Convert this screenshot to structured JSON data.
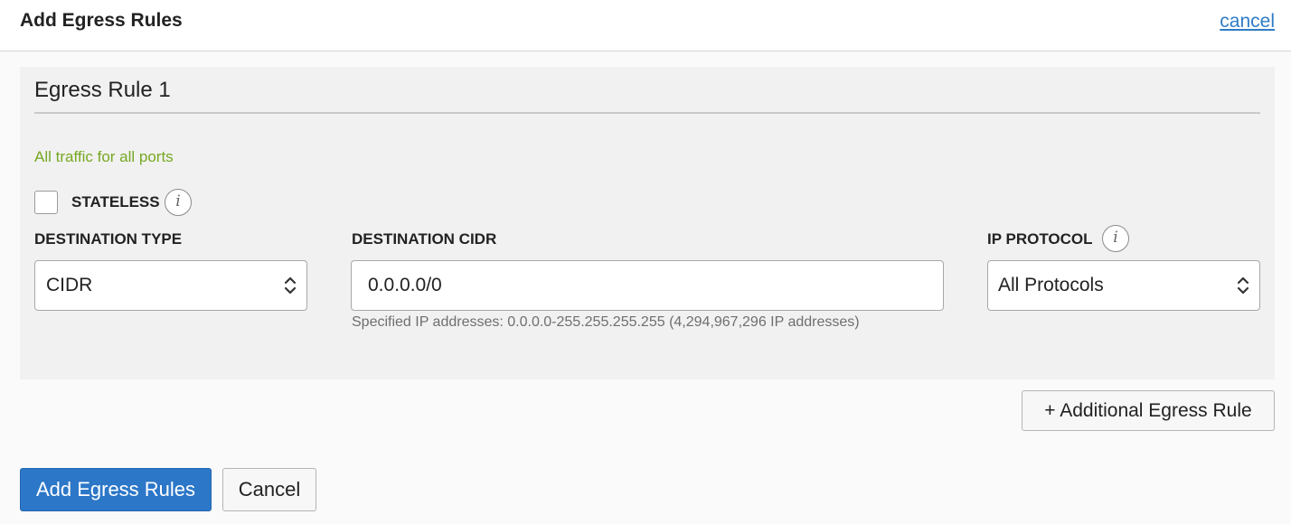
{
  "header": {
    "title": "Add Egress Rules",
    "cancel_link": "cancel"
  },
  "rule": {
    "title": "Egress Rule 1",
    "note": "All traffic for all ports",
    "stateless_label": "STATELESS",
    "stateless_checked": false,
    "destination_type": {
      "label": "DESTINATION TYPE",
      "value": "CIDR"
    },
    "destination_cidr": {
      "label": "DESTINATION CIDR",
      "value": "0.0.0.0/0",
      "helper": "Specified IP addresses: 0.0.0.0-255.255.255.255 (4,294,967,296 IP addresses)"
    },
    "ip_protocol": {
      "label": "IP PROTOCOL",
      "value": "All Protocols"
    },
    "info_icon_glyph": "i"
  },
  "buttons": {
    "additional_rule": "+ Additional Egress Rule",
    "submit": "Add Egress Rules",
    "cancel": "Cancel"
  },
  "colors": {
    "primary": "#2c77c8",
    "link": "#2e7cc6",
    "note": "#77a822"
  },
  "icons": {
    "info": "info-icon",
    "select_arrows": "updown-chevron-icon"
  }
}
